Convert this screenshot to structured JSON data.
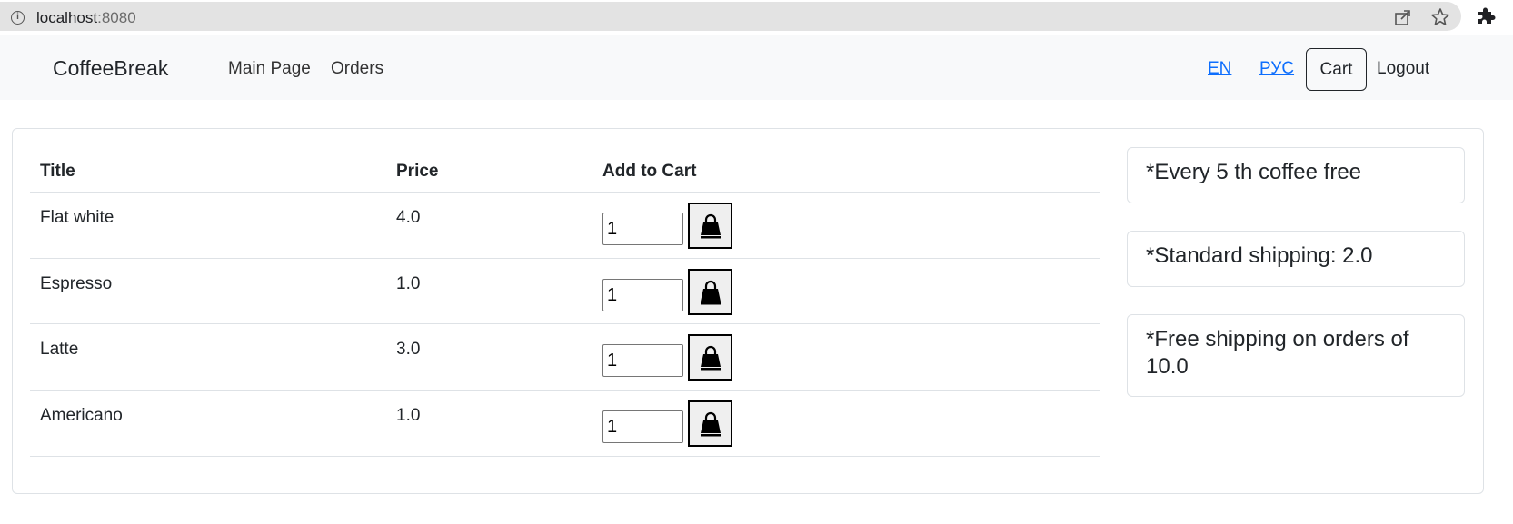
{
  "browser": {
    "url_host": "localhost",
    "url_port": ":8080",
    "info_symbol": "i"
  },
  "navbar": {
    "brand": "CoffeeBreak",
    "links": [
      "Main Page",
      "Orders"
    ],
    "languages": [
      "EN",
      "РУС"
    ],
    "cart_label": "Cart",
    "logout_label": "Logout"
  },
  "table": {
    "headers": [
      "Title",
      "Price",
      "Add to Cart"
    ],
    "rows": [
      {
        "title": "Flat white",
        "price": "4.0",
        "qty": "1"
      },
      {
        "title": "Espresso",
        "price": "1.0",
        "qty": "1"
      },
      {
        "title": "Latte",
        "price": "3.0",
        "qty": "1"
      },
      {
        "title": "Americano",
        "price": "1.0",
        "qty": "1"
      }
    ]
  },
  "info_cards": [
    "*Every 5 th coffee free",
    "*Standard shipping: 2.0",
    "*Free shipping on orders of 10.0"
  ],
  "icons": {
    "add_to_cart": "shopping-bag-icon"
  },
  "colors": {
    "navbar_bg": "#f8f9fa",
    "link": "#0d6efd"
  }
}
